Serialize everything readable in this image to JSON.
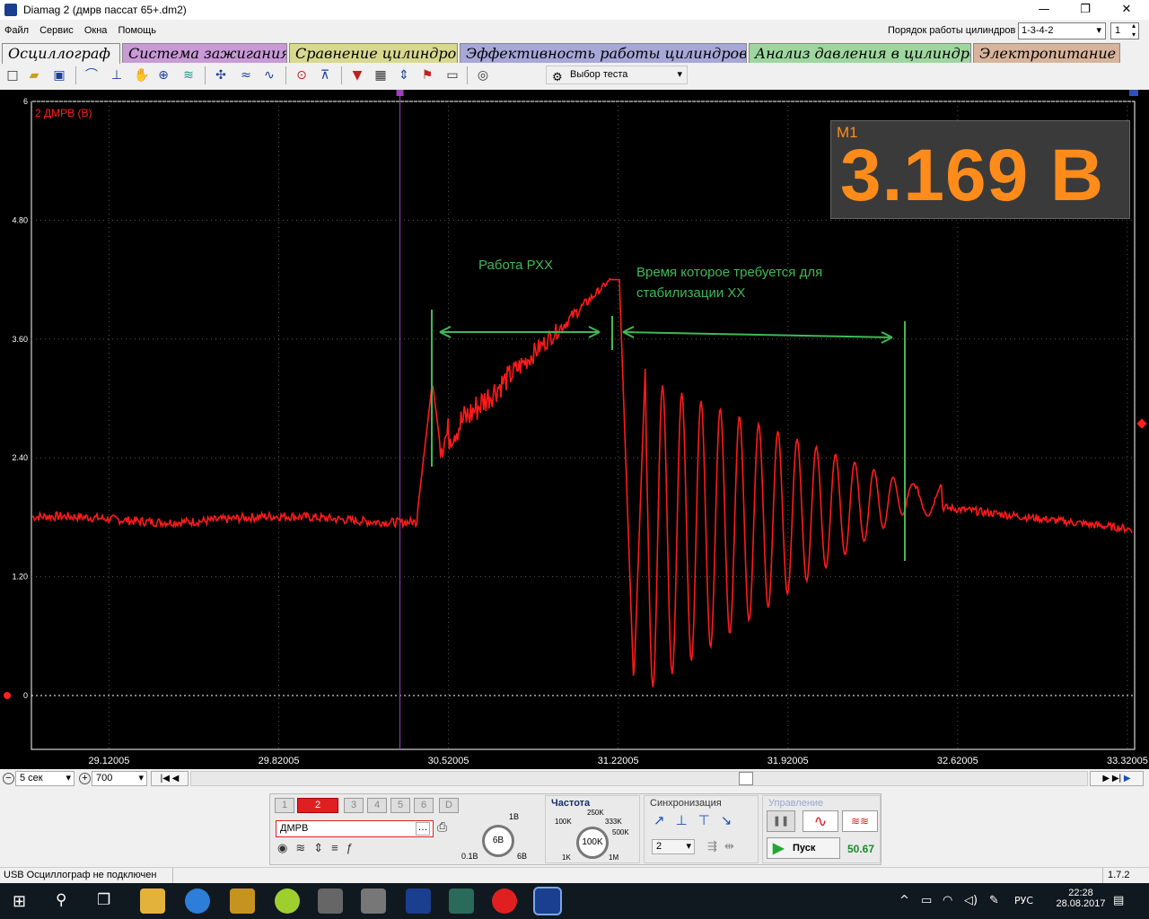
{
  "window": {
    "title": "Diamag 2 (дмрв пассат 65+.dm2)",
    "minimize": "—",
    "maximize": "❐",
    "close": "✕"
  },
  "menu": [
    "Файл",
    "Сервис",
    "Окна",
    "Помощь"
  ],
  "cylinder_order": {
    "label": "Порядок работы цилиндров",
    "value": "1-3-4-2",
    "number": "1"
  },
  "tabs": [
    {
      "label": "Осциллограф",
      "color": "#f0f0f0",
      "active": true
    },
    {
      "label": "Система зажигания",
      "color": "#c99ad6"
    },
    {
      "label": "Сравнение цилиндров",
      "color": "#d8d890"
    },
    {
      "label": "Эффективность работы цилиндров",
      "color": "#a7a7d8"
    },
    {
      "label": "Анализ давления в цилиндре",
      "color": "#9fd69f"
    },
    {
      "label": "Электропитание",
      "color": "#d8b49c"
    }
  ],
  "toolbar": {
    "test_select": "Выбор теста"
  },
  "plot": {
    "channel_label": "2 ДМРВ (В)",
    "marker1": "1",
    "marker2": "2",
    "measurement": {
      "label": "M1",
      "value": "3.169 В"
    },
    "annotations": {
      "rxx": "Работа РХХ",
      "stab_line1": "Время которое требуется для",
      "stab_line2": "стабилизации ХХ"
    },
    "colors": {
      "trace": "#ff1a1a",
      "annotation": "#3fb957",
      "marker": "#a040c0"
    }
  },
  "chart_data": {
    "type": "line",
    "title": "",
    "series": [
      {
        "name": "2 ДМРВ (В)",
        "values": []
      }
    ],
    "y_ticks": [
      "6",
      "4.80",
      "3.60",
      "2.40",
      "1.20",
      "0"
    ],
    "x_ticks": [
      "29.12005",
      "29.82005",
      "30.52005",
      "31.22005",
      "31.92005",
      "32.62005",
      "33.32005"
    ],
    "ylim": [
      0,
      6
    ],
    "xlim": [
      28.8,
      33.35
    ],
    "grid": true
  },
  "bottom": {
    "time_per_div": "5 сек",
    "zoom": "700",
    "channels": [
      "1",
      "2",
      "3",
      "4",
      "5",
      "6",
      "D"
    ],
    "channel_name": "ДМРВ",
    "voltage": "6В",
    "voltage_low": "0.1В",
    "voltage_high": "6В",
    "voltage_top": "1В",
    "freq_label": "Частота",
    "freq_value": "100K",
    "freq_opts": [
      "100K",
      "250K",
      "333K",
      "500K",
      "1K",
      "1M"
    ],
    "sync_label": "Синхронизация",
    "sync_value": "2",
    "control_label": "Управление",
    "start": "Пуск",
    "rate": "50.67"
  },
  "status": {
    "text": "USB Осциллограф не подключен",
    "version": "1.7.2"
  },
  "taskbar": {
    "lang": "РУС",
    "time": "22:28",
    "date": "28.08.2017"
  }
}
